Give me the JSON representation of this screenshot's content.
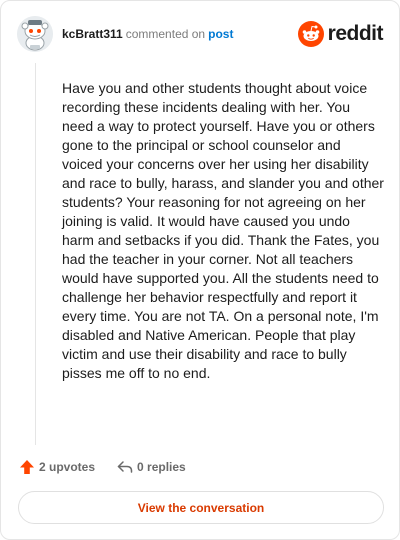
{
  "comment": {
    "username": "kcBratt311",
    "action_text": "commented on",
    "post_link": "post",
    "body": "Have you and other students thought about voice recording these incidents dealing with her. You need a way to protect yourself. Have you or others gone to the principal or school counselor and voiced your concerns over her using her disability and race to bully, harass, and slander you and other students? Your reasoning for not agreeing on her joining is valid. It would have caused you undo harm and setbacks if you did. Thank the Fates, you had the teacher in your corner. Not all teachers would have supported you. All the students need to challenge her behavior respectfully and report it every time. You are not TA. On a personal note, I'm disabled and Native American. People that play victim and use their disability and race to bully pisses me off to no end."
  },
  "brand": {
    "name": "reddit",
    "icon": "reddit-logo-icon",
    "color": "#ff4500"
  },
  "actions": {
    "upvotes_label": "2 upvotes",
    "replies_label": "0 replies",
    "upvote_icon": "upvote-arrow-icon",
    "reply_icon": "reply-arrow-icon",
    "upvote_color": "#ff4500"
  },
  "cta": {
    "label": "View the conversation",
    "color": "#d93a00"
  },
  "avatar": {
    "icon": "snoo-avatar-icon"
  }
}
